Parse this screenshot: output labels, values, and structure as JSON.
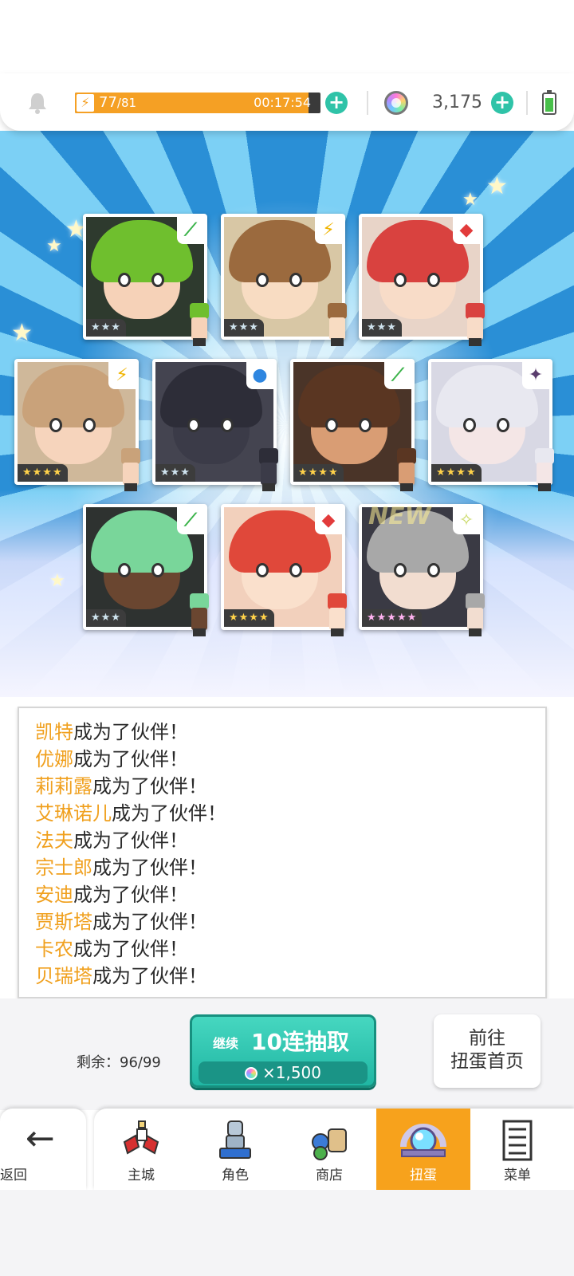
{
  "status": {
    "stamina_current": "77",
    "stamina_max": "/81",
    "stamina_fraction": 0.95,
    "stamina_timer": "00:17:54",
    "gem_count": "3,175",
    "bolt_icon": "⚡",
    "plus_symbol": "+"
  },
  "cards": [
    {
      "element": "leaf",
      "element_symbol": "⟋",
      "element_color": "#3bb34a",
      "rarity": "★★★",
      "rarity_class": "silver",
      "hair": "#6fbf2e",
      "skin": "#f6d2b8",
      "bg": "#2e3a2e"
    },
    {
      "element": "lightning",
      "element_symbol": "⚡",
      "element_color": "#f0b400",
      "rarity": "★★★",
      "rarity_class": "silver",
      "hair": "#9b6a3e",
      "skin": "#f8dcc2",
      "bg": "#d8c7a5"
    },
    {
      "element": "fire",
      "element_symbol": "◆",
      "element_color": "#e23b3b",
      "rarity": "★★★",
      "rarity_class": "silver",
      "hair": "#d9423f",
      "skin": "#f8dcc8",
      "bg": "#e8d4c8"
    },
    {
      "element": "lightning",
      "element_symbol": "⚡",
      "element_color": "#f0b400",
      "rarity": "★★★★",
      "rarity_class": "gold",
      "hair": "#c9a27a",
      "skin": "#f6d4bc",
      "bg": "#cfb89a"
    },
    {
      "element": "water",
      "element_symbol": "●",
      "element_color": "#2e86e0",
      "rarity": "★★★",
      "rarity_class": "silver",
      "hair": "#2d2d38",
      "skin": "#3b3b48",
      "bg": "#444450"
    },
    {
      "element": "leaf",
      "element_symbol": "⟋",
      "element_color": "#3bb34a",
      "rarity": "★★★★",
      "rarity_class": "gold",
      "hair": "#5a3622",
      "skin": "#d99d74",
      "bg": "#4a3428"
    },
    {
      "element": "dark",
      "element_symbol": "✦",
      "element_color": "#5a3d6e",
      "rarity": "★★★★",
      "rarity_class": "gold",
      "hair": "#e8e8f0",
      "skin": "#f4e6e6",
      "bg": "#d8d8e4"
    },
    {
      "element": "leaf",
      "element_symbol": "⟋",
      "element_color": "#3bb34a",
      "rarity": "★★★",
      "rarity_class": "silver",
      "hair": "#79d69a",
      "skin": "#6a4630",
      "bg": "#2e3230"
    },
    {
      "element": "fire",
      "element_symbol": "◆",
      "element_color": "#e23b3b",
      "rarity": "★★★★",
      "rarity_class": "gold",
      "hair": "#e0483a",
      "skin": "#fae0cc",
      "bg": "#f2d0bc"
    },
    {
      "element": "light",
      "element_symbol": "✧",
      "element_color": "#c8d860",
      "rarity": "★★★★★",
      "rarity_class": "rainbow",
      "hair": "#a8a8a8",
      "skin": "#f2ddd0",
      "bg": "#3a3a44"
    }
  ],
  "new_label": "NEW",
  "log_suffix": "成为了伙伴！",
  "log": [
    {
      "name": "凯特"
    },
    {
      "name": "优娜"
    },
    {
      "name": "莉莉露"
    },
    {
      "name": "艾琳诺儿"
    },
    {
      "name": "法夫"
    },
    {
      "name": "宗士郎"
    },
    {
      "name": "安迪"
    },
    {
      "name": "贾斯塔"
    },
    {
      "name": "卡农"
    },
    {
      "name": "贝瑞塔"
    }
  ],
  "action": {
    "remaining": "剩余：96/99",
    "draw_prefix": "继续",
    "draw_label": "10连抽取",
    "draw_cost": "×1,500",
    "goto_line1": "前往",
    "goto_line2": "扭蛋首页"
  },
  "nav": {
    "back": "返回",
    "tabs": [
      {
        "label": "主城",
        "icon": "castle-icon"
      },
      {
        "label": "角色",
        "icon": "character-icon"
      },
      {
        "label": "商店",
        "icon": "shop-icon"
      },
      {
        "label": "扭蛋",
        "icon": "gacha-icon",
        "active": true
      },
      {
        "label": "菜单",
        "icon": "menu-icon"
      }
    ],
    "active_color": "#f7a21c"
  },
  "colors": {
    "accent": "#2fc3a8",
    "stamina": "#f5a024",
    "name_highlight": "#f0a01e"
  }
}
